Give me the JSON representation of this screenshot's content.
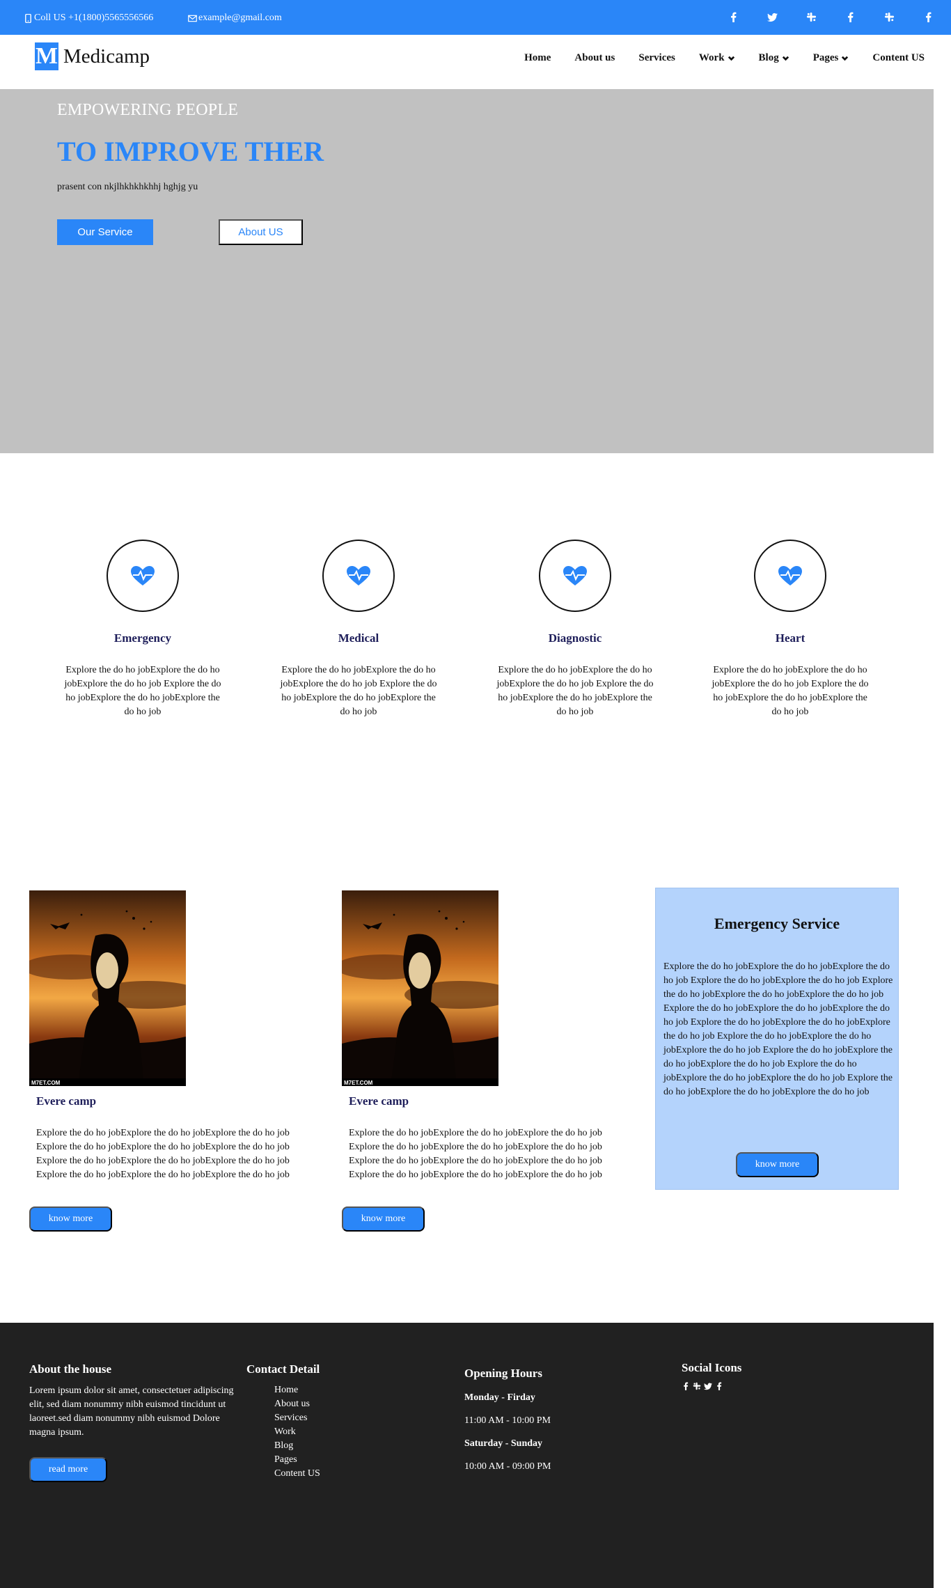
{
  "topbar": {
    "phone": "Coll US +1(1800)5565556566",
    "email": "example@gmail.com",
    "social_icons": [
      "facebook-icon",
      "twitter-icon",
      "slack-icon",
      "facebook-icon",
      "slack-icon",
      "facebook-icon"
    ]
  },
  "nav": {
    "logo_letter": "M",
    "logo_text": "Medicamp",
    "items": [
      {
        "label": "Home"
      },
      {
        "label": "About us"
      },
      {
        "label": "Services"
      },
      {
        "label": "Work"
      },
      {
        "label": "Blog"
      },
      {
        "label": "Pages"
      },
      {
        "label": "Content US"
      }
    ]
  },
  "hero": {
    "kicker": "EMPOWERING PEOPLE",
    "headline": "TO IMPROVE THER",
    "sub": "prasent con nkjlhkhkhkhhj hghjg yu",
    "primary_button": "Our Service",
    "secondary_button": "About US",
    "background_color": "#c1c1c1"
  },
  "features": [
    {
      "icon": "heartbeat-icon",
      "title": "Emergency",
      "text": "Explore the do ho jobExplore the do ho jobExplore the do ho job Explore the do ho jobExplore the do ho jobExplore the do ho job"
    },
    {
      "icon": "heartbeat-icon",
      "title": "Medical",
      "text": "Explore the do ho jobExplore the do ho jobExplore the do ho job Explore the do ho jobExplore the do ho jobExplore the do ho job"
    },
    {
      "icon": "heartbeat-icon",
      "title": "Diagnostic",
      "text": "Explore the do ho jobExplore the do ho jobExplore the do ho job Explore the do ho jobExplore the do ho jobExplore the do ho job"
    },
    {
      "icon": "heartbeat-icon",
      "title": "Heart",
      "text": "Explore the do ho jobExplore the do ho jobExplore the do ho job Explore the do ho jobExplore the do ho jobExplore the do ho job"
    }
  ],
  "cards": [
    {
      "title": "Evere camp",
      "text": "Explore the do ho jobExplore the do ho jobExplore the do ho job Explore the do ho jobExplore the do ho jobExplore the do ho job Explore the do ho jobExplore the do ho jobExplore the do ho job Explore the do ho jobExplore the do ho jobExplore the do ho job",
      "button": "know more",
      "image_caption": "M7ET.COM"
    },
    {
      "title": "Evere camp",
      "text": "Explore the do ho jobExplore the do ho jobExplore the do ho job Explore the do ho jobExplore the do ho jobExplore the do ho job Explore the do ho jobExplore the do ho jobExplore the do ho job Explore the do ho jobExplore the do ho jobExplore the do ho job",
      "button": "know more",
      "image_caption": "M7ET.COM"
    }
  ],
  "emergency": {
    "title": "Emergency Service",
    "text": "Explore the do ho jobExplore the do ho jobExplore the do ho job Explore the do ho jobExplore the do ho job Explore the do ho jobExplore the do ho jobExplore the do ho job Explore the do ho jobExplore the do ho jobExplore the do ho job Explore the do ho jobExplore the do ho jobExplore the do ho job Explore the do ho jobExplore the do ho jobExplore the do ho job Explore the do ho jobExplore the do ho jobExplore the do ho job Explore the do ho jobExplore the do ho jobExplore the do ho job Explore the do ho jobExplore the do ho jobExplore the do ho job",
    "button": "know more",
    "background_color": "#b4d3fc"
  },
  "footer": {
    "about": {
      "heading": "About the house",
      "text": "Lorem ipsum dolor sit amet, consectetuer adipiscing elit, sed diam nonummy nibh euismod tincidunt ut laoreet.sed diam nonummy nibh euismod Dolore magna ipsum.",
      "button": "read more"
    },
    "contact": {
      "heading": "Contact Detail",
      "links": [
        "Home",
        "About us",
        "Services",
        "Work",
        "Blog",
        "Pages",
        "Content US"
      ]
    },
    "hours": {
      "heading": "Opening Hours",
      "weekday_label": "Monday - Firday",
      "weekday_time": "11:00 AM - 10:00 PM",
      "weekend_label": "Saturday - Sunday",
      "weekend_time": "10:00 AM - 09:00 PM"
    },
    "social": {
      "heading": "Social Icons",
      "icons": [
        "facebook-icon",
        "slack-icon",
        "twitter-icon",
        "facebook-icon"
      ]
    },
    "background_color": "#212121"
  },
  "colors": {
    "accent": "#2a86f8",
    "heading_dark": "#1e1e5a"
  }
}
